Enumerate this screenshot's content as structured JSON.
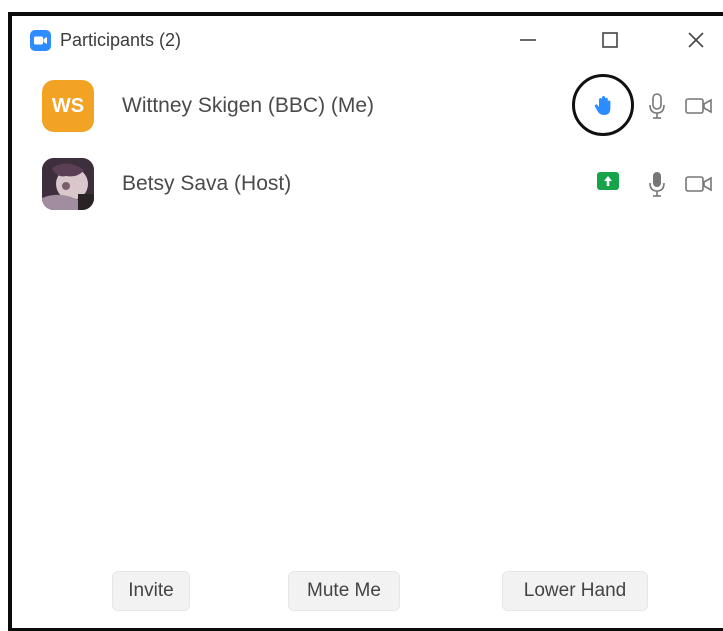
{
  "window": {
    "title": "Participants (2)",
    "controls": {
      "minimize_icon": "minimize-icon",
      "maximize_icon": "maximize-icon",
      "close_icon": "close-icon"
    }
  },
  "participants": [
    {
      "name": "Wittney Skigen (BBC) (Me)",
      "initials": "WS",
      "avatar_color": "#f3a324",
      "status_icon": "raised-hand-icon",
      "mic_icon": "microphone-icon",
      "video_icon": "video-camera-icon"
    },
    {
      "name": "Betsy Sava (Host)",
      "avatar": "photo",
      "status_icon": "screen-share-icon",
      "mic_icon": "microphone-icon",
      "video_icon": "video-camera-icon"
    }
  ],
  "footer": {
    "invite_label": "Invite",
    "mute_label": "Mute Me",
    "lower_hand_label": "Lower Hand"
  },
  "colors": {
    "accent": "#2d8cff",
    "share_green": "#17a34a",
    "avatar_orange": "#f3a324"
  }
}
